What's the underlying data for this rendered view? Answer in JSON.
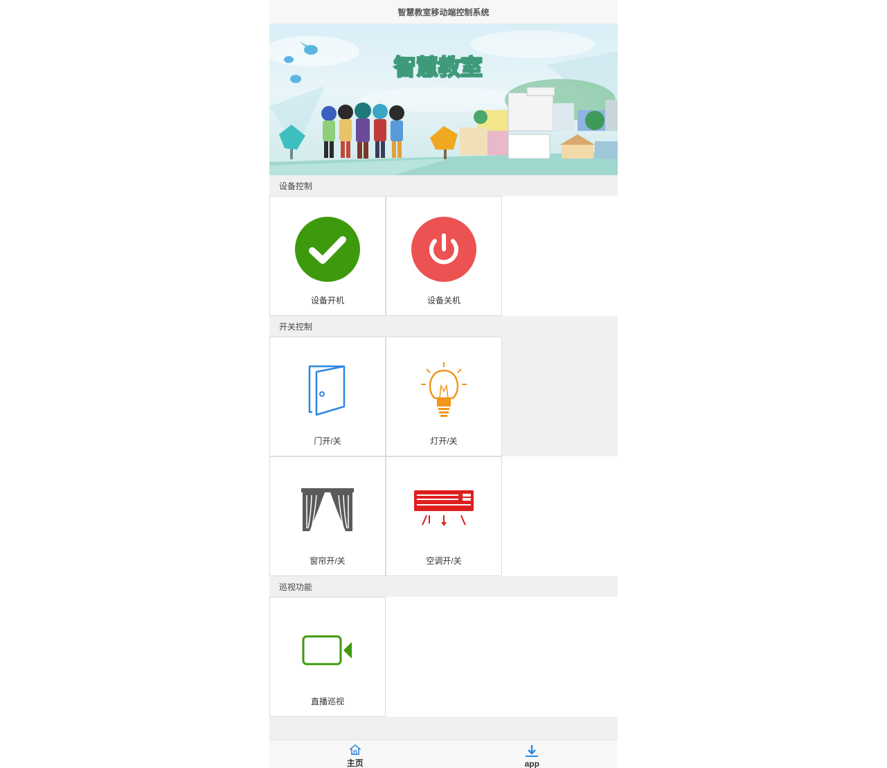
{
  "header": {
    "title": "智慧教室移动端控制系统"
  },
  "banner": {
    "headline": "智慧教室"
  },
  "sections": {
    "device_control": {
      "title": "设备控制",
      "items": [
        {
          "label": "设备开机",
          "icon": "check-circle-icon",
          "color": "#3d9a0c"
        },
        {
          "label": "设备关机",
          "icon": "power-icon",
          "color": "#ec5252"
        }
      ]
    },
    "switch_control": {
      "title": "开关控制",
      "items": [
        {
          "label": "门开/关",
          "icon": "door-icon",
          "color": "#2f86e0"
        },
        {
          "label": "灯开/关",
          "icon": "light-bulb-icon",
          "color": "#f0961a"
        },
        {
          "label": "窗帘开/关",
          "icon": "curtain-icon",
          "color": "#5a5a5a"
        },
        {
          "label": "空调开/关",
          "icon": "air-conditioner-icon",
          "color": "#e01f1f"
        }
      ]
    },
    "patrol": {
      "title": "巡视功能",
      "items": [
        {
          "label": "直播巡视",
          "icon": "video-camera-icon",
          "color": "#3d9a0c"
        }
      ]
    }
  },
  "tabbar": {
    "items": [
      {
        "label": "主页",
        "icon": "home-icon"
      },
      {
        "label": "app",
        "icon": "download-icon"
      }
    ],
    "accent": "#2f86e0"
  }
}
